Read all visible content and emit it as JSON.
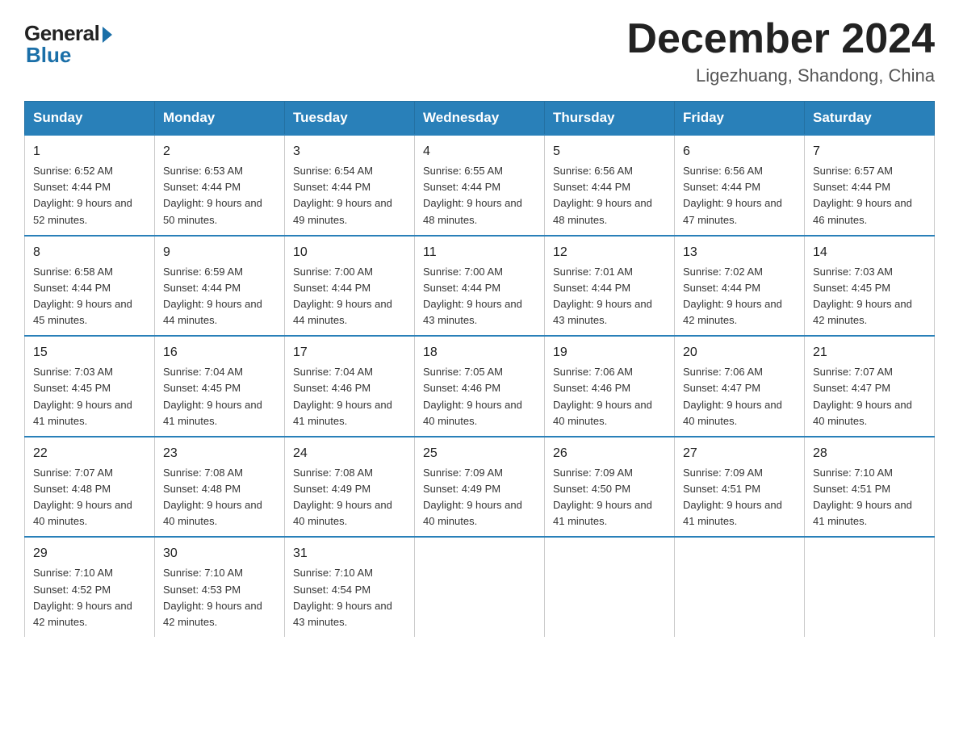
{
  "logo": {
    "general": "General",
    "blue": "Blue"
  },
  "header": {
    "month": "December 2024",
    "location": "Ligezhuang, Shandong, China"
  },
  "weekdays": [
    "Sunday",
    "Monday",
    "Tuesday",
    "Wednesday",
    "Thursday",
    "Friday",
    "Saturday"
  ],
  "weeks": [
    [
      {
        "day": "1",
        "sunrise": "6:52 AM",
        "sunset": "4:44 PM",
        "daylight": "9 hours and 52 minutes."
      },
      {
        "day": "2",
        "sunrise": "6:53 AM",
        "sunset": "4:44 PM",
        "daylight": "9 hours and 50 minutes."
      },
      {
        "day": "3",
        "sunrise": "6:54 AM",
        "sunset": "4:44 PM",
        "daylight": "9 hours and 49 minutes."
      },
      {
        "day": "4",
        "sunrise": "6:55 AM",
        "sunset": "4:44 PM",
        "daylight": "9 hours and 48 minutes."
      },
      {
        "day": "5",
        "sunrise": "6:56 AM",
        "sunset": "4:44 PM",
        "daylight": "9 hours and 48 minutes."
      },
      {
        "day": "6",
        "sunrise": "6:56 AM",
        "sunset": "4:44 PM",
        "daylight": "9 hours and 47 minutes."
      },
      {
        "day": "7",
        "sunrise": "6:57 AM",
        "sunset": "4:44 PM",
        "daylight": "9 hours and 46 minutes."
      }
    ],
    [
      {
        "day": "8",
        "sunrise": "6:58 AM",
        "sunset": "4:44 PM",
        "daylight": "9 hours and 45 minutes."
      },
      {
        "day": "9",
        "sunrise": "6:59 AM",
        "sunset": "4:44 PM",
        "daylight": "9 hours and 44 minutes."
      },
      {
        "day": "10",
        "sunrise": "7:00 AM",
        "sunset": "4:44 PM",
        "daylight": "9 hours and 44 minutes."
      },
      {
        "day": "11",
        "sunrise": "7:00 AM",
        "sunset": "4:44 PM",
        "daylight": "9 hours and 43 minutes."
      },
      {
        "day": "12",
        "sunrise": "7:01 AM",
        "sunset": "4:44 PM",
        "daylight": "9 hours and 43 minutes."
      },
      {
        "day": "13",
        "sunrise": "7:02 AM",
        "sunset": "4:44 PM",
        "daylight": "9 hours and 42 minutes."
      },
      {
        "day": "14",
        "sunrise": "7:03 AM",
        "sunset": "4:45 PM",
        "daylight": "9 hours and 42 minutes."
      }
    ],
    [
      {
        "day": "15",
        "sunrise": "7:03 AM",
        "sunset": "4:45 PM",
        "daylight": "9 hours and 41 minutes."
      },
      {
        "day": "16",
        "sunrise": "7:04 AM",
        "sunset": "4:45 PM",
        "daylight": "9 hours and 41 minutes."
      },
      {
        "day": "17",
        "sunrise": "7:04 AM",
        "sunset": "4:46 PM",
        "daylight": "9 hours and 41 minutes."
      },
      {
        "day": "18",
        "sunrise": "7:05 AM",
        "sunset": "4:46 PM",
        "daylight": "9 hours and 40 minutes."
      },
      {
        "day": "19",
        "sunrise": "7:06 AM",
        "sunset": "4:46 PM",
        "daylight": "9 hours and 40 minutes."
      },
      {
        "day": "20",
        "sunrise": "7:06 AM",
        "sunset": "4:47 PM",
        "daylight": "9 hours and 40 minutes."
      },
      {
        "day": "21",
        "sunrise": "7:07 AM",
        "sunset": "4:47 PM",
        "daylight": "9 hours and 40 minutes."
      }
    ],
    [
      {
        "day": "22",
        "sunrise": "7:07 AM",
        "sunset": "4:48 PM",
        "daylight": "9 hours and 40 minutes."
      },
      {
        "day": "23",
        "sunrise": "7:08 AM",
        "sunset": "4:48 PM",
        "daylight": "9 hours and 40 minutes."
      },
      {
        "day": "24",
        "sunrise": "7:08 AM",
        "sunset": "4:49 PM",
        "daylight": "9 hours and 40 minutes."
      },
      {
        "day": "25",
        "sunrise": "7:09 AM",
        "sunset": "4:49 PM",
        "daylight": "9 hours and 40 minutes."
      },
      {
        "day": "26",
        "sunrise": "7:09 AM",
        "sunset": "4:50 PM",
        "daylight": "9 hours and 41 minutes."
      },
      {
        "day": "27",
        "sunrise": "7:09 AM",
        "sunset": "4:51 PM",
        "daylight": "9 hours and 41 minutes."
      },
      {
        "day": "28",
        "sunrise": "7:10 AM",
        "sunset": "4:51 PM",
        "daylight": "9 hours and 41 minutes."
      }
    ],
    [
      {
        "day": "29",
        "sunrise": "7:10 AM",
        "sunset": "4:52 PM",
        "daylight": "9 hours and 42 minutes."
      },
      {
        "day": "30",
        "sunrise": "7:10 AM",
        "sunset": "4:53 PM",
        "daylight": "9 hours and 42 minutes."
      },
      {
        "day": "31",
        "sunrise": "7:10 AM",
        "sunset": "4:54 PM",
        "daylight": "9 hours and 43 minutes."
      },
      null,
      null,
      null,
      null
    ]
  ],
  "colors": {
    "header_bg": "#2980b9",
    "border": "#2471a3",
    "week_border": "#2980b9"
  }
}
